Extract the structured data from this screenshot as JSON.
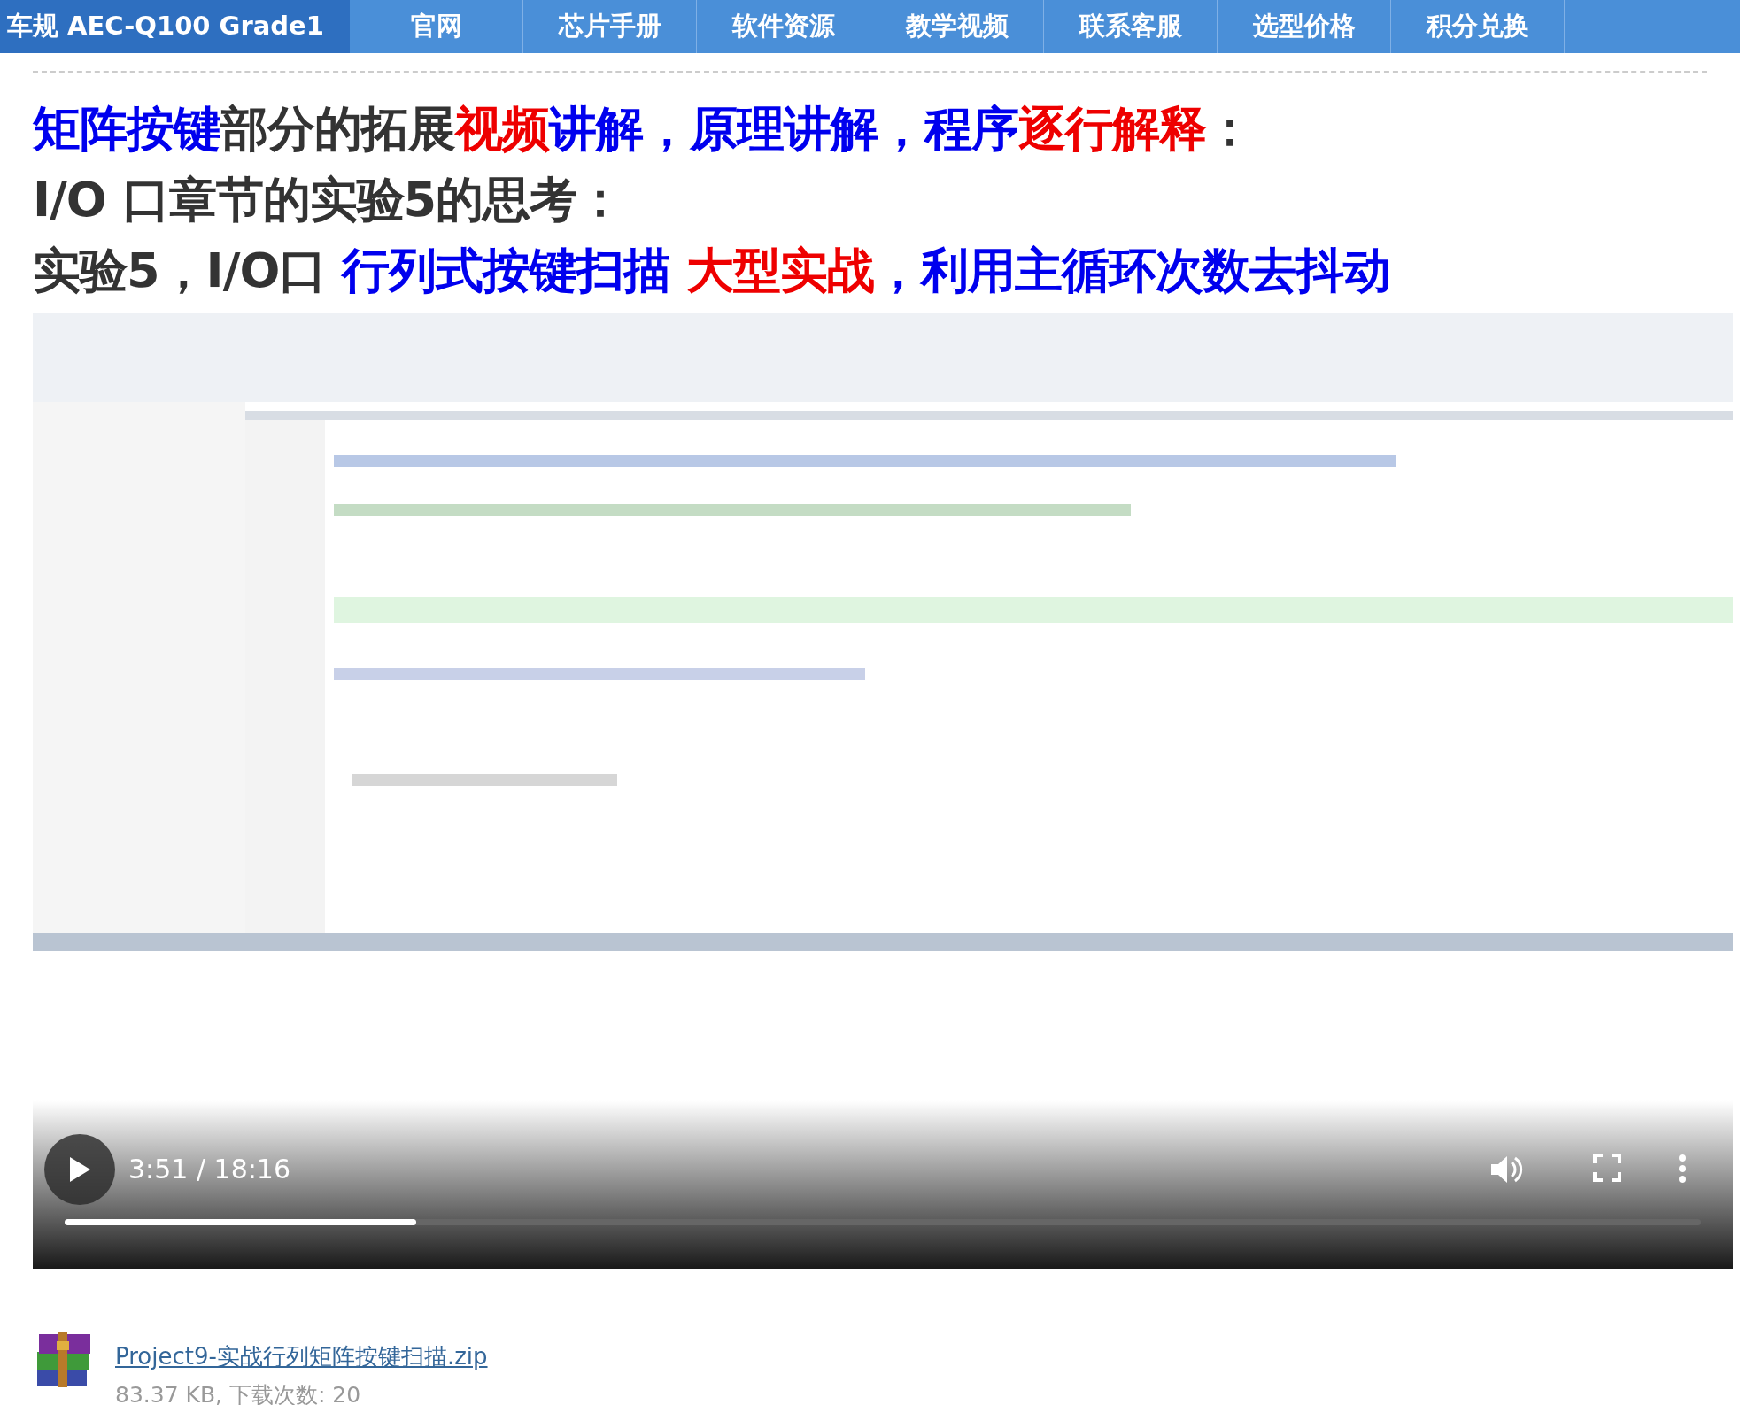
{
  "nav": {
    "brand": "车规 AEC-Q100 Grade1",
    "items": [
      "官网",
      "芯片手册",
      "软件资源",
      "教学视频",
      "联系客服",
      "选型价格",
      "积分兑换"
    ]
  },
  "headings": [
    {
      "segments": [
        {
          "text": "矩阵按键",
          "color": "#0000ee"
        },
        {
          "text": "部分的拓展",
          "color": "#333333"
        },
        {
          "text": "视频",
          "color": "#ee0000"
        },
        {
          "text": "讲解，原理讲解，程序",
          "color": "#0000ee"
        },
        {
          "text": "逐行解释",
          "color": "#ee0000"
        },
        {
          "text": "：",
          "color": "#333333"
        }
      ]
    },
    {
      "segments": [
        {
          "text": "I/O 口章节的实验5的思考：",
          "color": "#333333"
        }
      ]
    },
    {
      "segments": [
        {
          "text": "实验5，I/O口 ",
          "color": "#333333"
        },
        {
          "text": "行列式按键扫描 ",
          "color": "#0000ee"
        },
        {
          "text": "大型实战",
          "color": "#ee0000"
        },
        {
          "text": "，利用主循环次数去抖动",
          "color": "#0000ee"
        }
      ]
    }
  ],
  "video": {
    "kind": "picture",
    "time": "3:51 / 18:16",
    "playing": false,
    "level": 0.215
  },
  "attachment": {
    "filename": "Project9-实战行列矩阵按键扫描.zip",
    "meta": "83.37 KB, 下载次数: 20"
  }
}
